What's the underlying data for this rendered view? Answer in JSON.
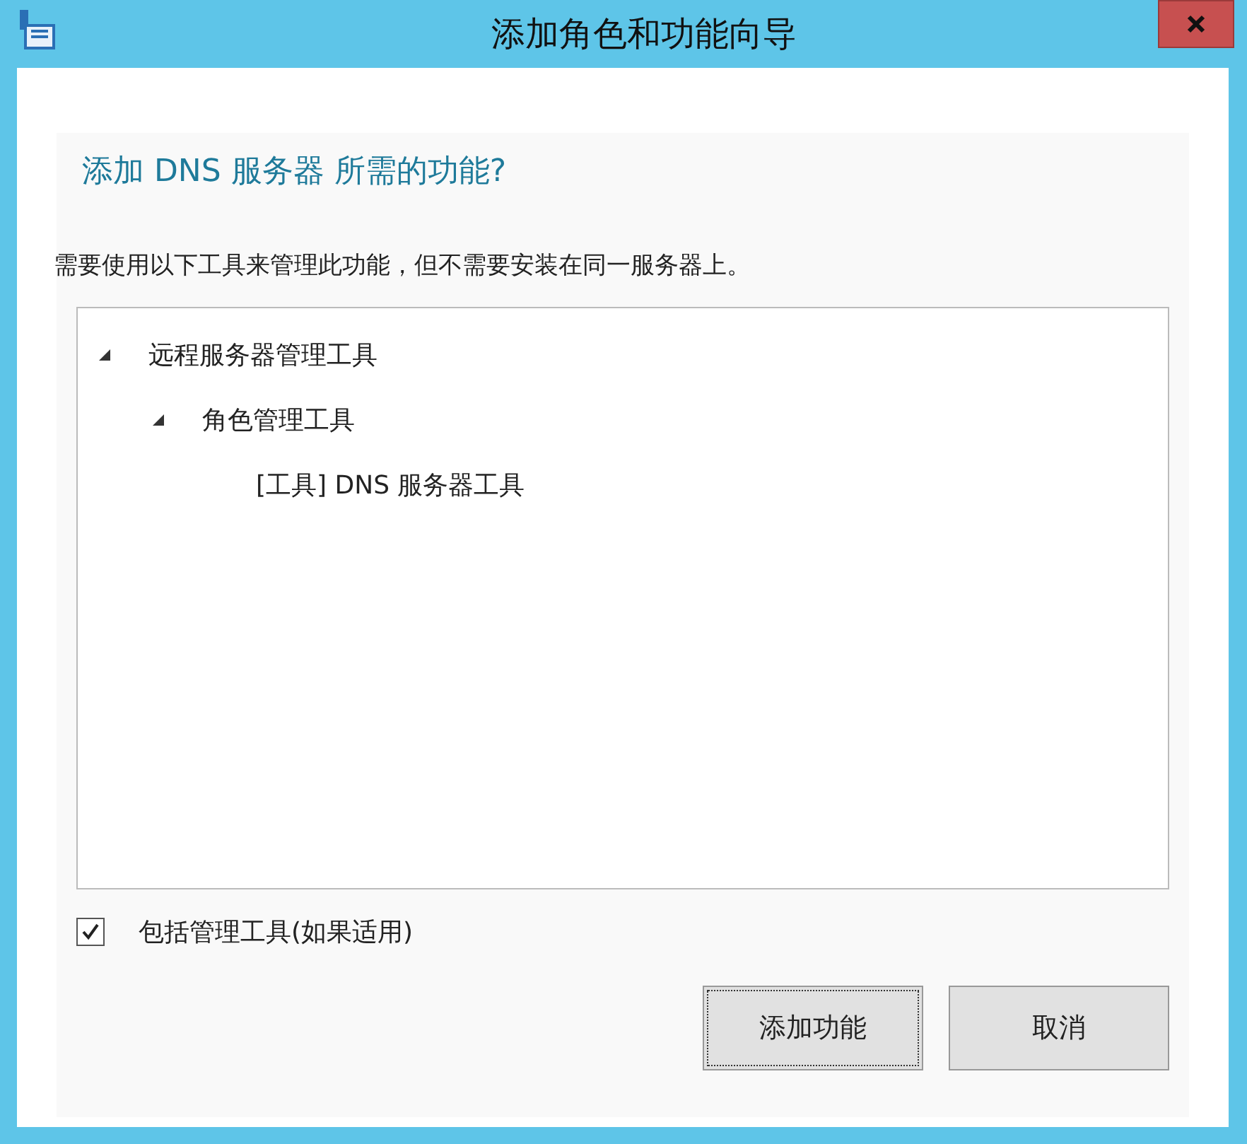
{
  "window": {
    "title": "添加角色和功能向导"
  },
  "heading": "添加 DNS 服务器 所需的功能?",
  "description": "需要使用以下工具来管理此功能，但不需要安装在同一服务器上。",
  "tree": [
    {
      "label": "远程服务器管理工具",
      "expanded": true,
      "children": [
        {
          "label": "角色管理工具",
          "expanded": true,
          "children": [
            {
              "label": "[工具] DNS 服务器工具"
            }
          ]
        }
      ]
    }
  ],
  "include_tools": {
    "label": "包括管理工具(如果适用)",
    "checked": true
  },
  "buttons": [
    {
      "label": "添加功能",
      "focused": true
    },
    {
      "label": "取消",
      "focused": false
    }
  ]
}
